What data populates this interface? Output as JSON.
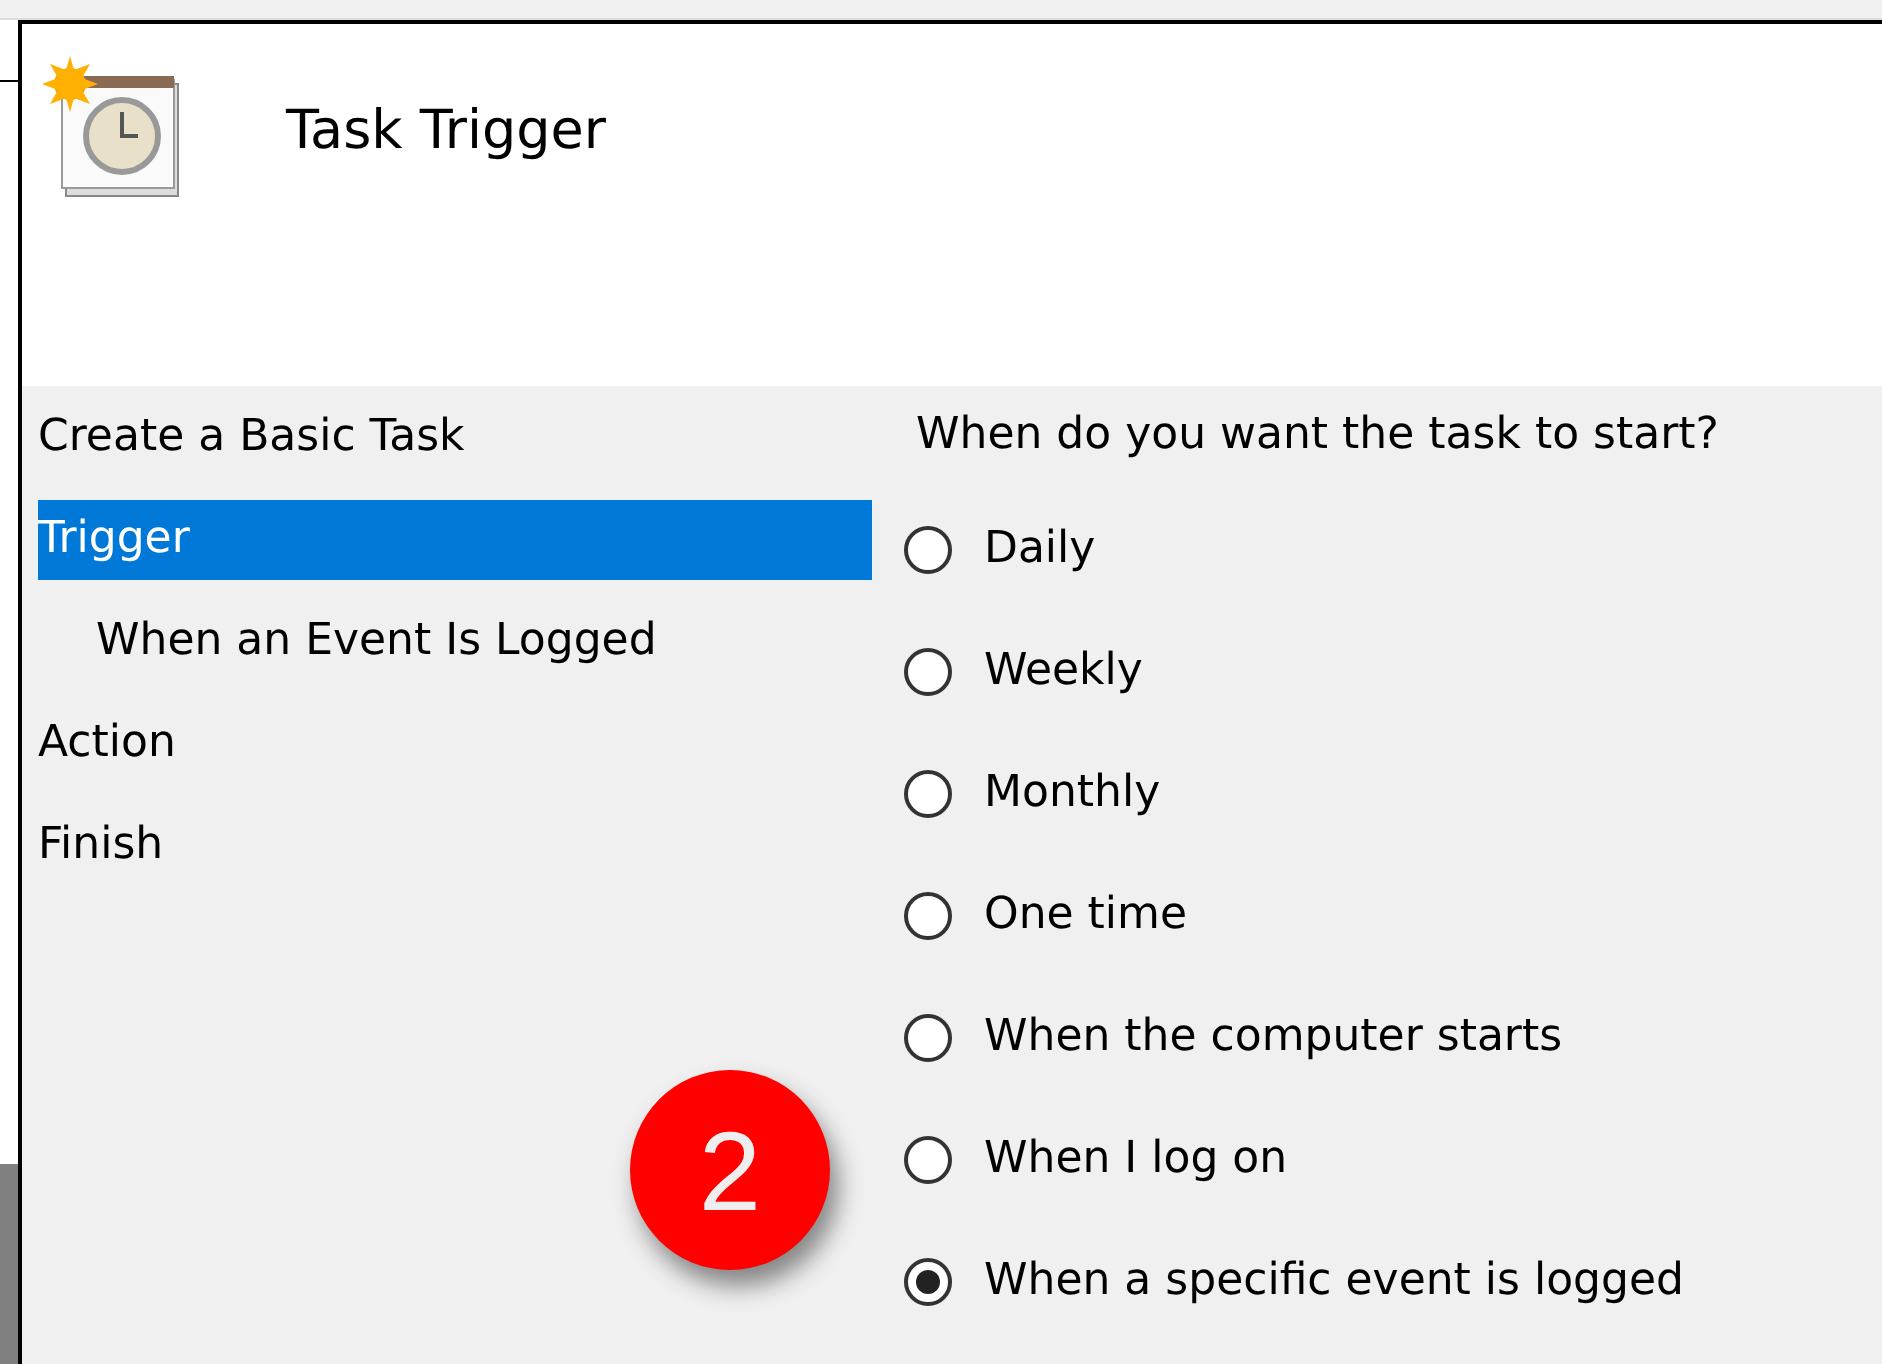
{
  "window": {
    "title": "Task Trigger"
  },
  "sidebar": {
    "items": [
      {
        "label": "Create a Basic Task",
        "selected": false
      },
      {
        "label": "Trigger",
        "selected": true,
        "children": [
          {
            "label": "When an Event Is Logged",
            "selected": false
          }
        ]
      },
      {
        "label": "Action",
        "selected": false
      },
      {
        "label": "Finish",
        "selected": false
      }
    ]
  },
  "question": "When do you want the task to start?",
  "options": [
    {
      "label": "Daily",
      "selected": false
    },
    {
      "label": "Weekly",
      "selected": false
    },
    {
      "label": "Monthly",
      "selected": false
    },
    {
      "label": "One time",
      "selected": false
    },
    {
      "label": "When the computer starts",
      "selected": false
    },
    {
      "label": "When I log on",
      "selected": false
    },
    {
      "label": "When a specific event is logged",
      "selected": true
    }
  ],
  "step_badge": "2"
}
